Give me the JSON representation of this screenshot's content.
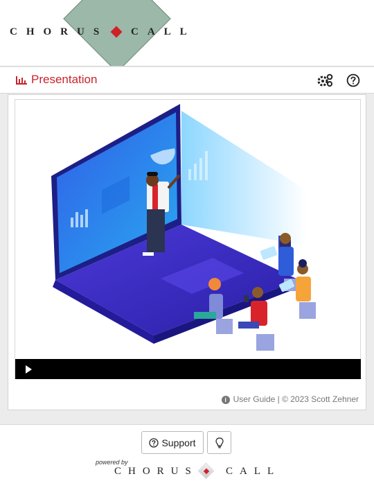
{
  "header": {
    "brand_left": "CHORUS",
    "brand_right": "CALL"
  },
  "titlebar": {
    "title": "Presentation",
    "chart_icon": "bar-chart-icon",
    "settings_icon": "gear-icon",
    "help_icon": "help-circle-icon"
  },
  "player": {
    "play_icon": "play-icon",
    "caption": "User Guide | © 2023 Scott Zehner",
    "info_icon": "info-icon"
  },
  "footer": {
    "support_label": "Support",
    "support_icon": "help-circle-icon",
    "tip_icon": "lightbulb-icon",
    "powered_by": "powered by",
    "brand_left": "CHORUS",
    "brand_right": "CALL"
  },
  "colors": {
    "accent": "#c8232c",
    "logo_diamond": "#9cb8a8",
    "video_bar": "#000000"
  }
}
